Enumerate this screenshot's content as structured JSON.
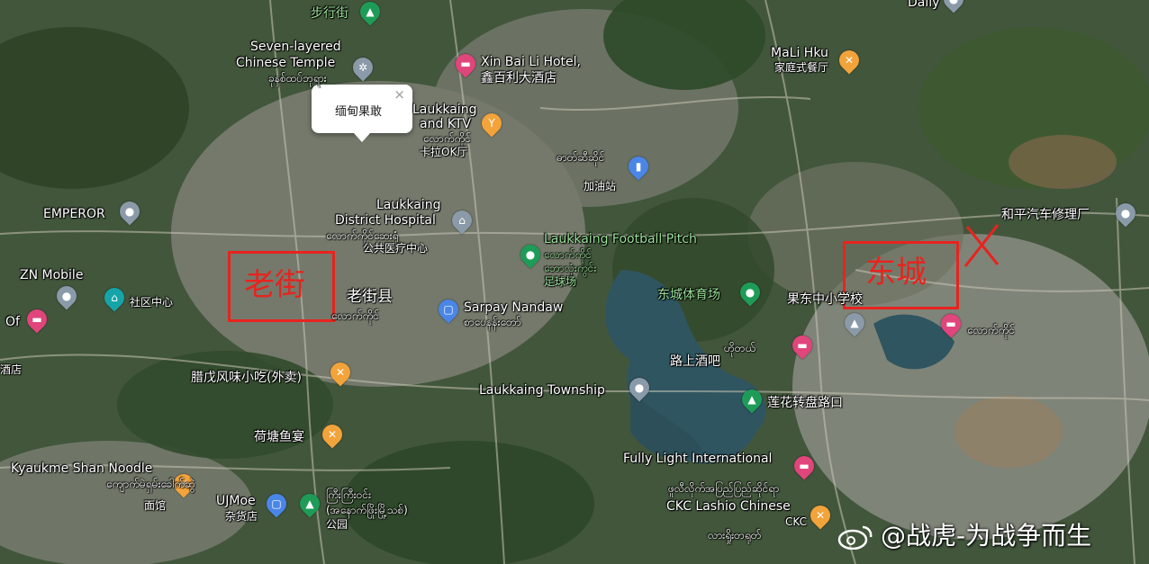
{
  "map": {
    "popup": {
      "text": "缅甸果敢",
      "close_icon": "×"
    },
    "annotations": {
      "old_street_box": "老街",
      "east_city_box": "东城",
      "cross_mark": "X"
    },
    "labels": {
      "walking_street": "步行街",
      "seven_layered_1": "Seven-layered",
      "seven_layered_2": "Chinese Temple",
      "seven_layered_sub": "ခုနစ်ထပ်ဘုရား",
      "xinbaili_1": "Xin Bai Li Hotel,",
      "xinbaili_2": "鑫百利大酒店",
      "ktv_1": "Laukkaing",
      "ktv_2": "and KTV",
      "ktv_sub": "လောက်ကိုင်",
      "ktv_3": "卡拉OK厅",
      "mali_hku": "MaLi Hku",
      "mali_hku_sub": "家庭式餐厅",
      "daily": "Daily",
      "gas_sub": "ဓာတ်ဆီဆိုင်",
      "gas_cn": "加油站",
      "emperor": "EMPEROR",
      "hospital_1": "Laukkaing",
      "hospital_2": "District Hospital",
      "hospital_sub": "လောက်ကိုင်ဆေးရုံ",
      "hospital_cn": "公共医疗中心",
      "football": "Laukkaing Football Pitch",
      "football_sub1": "လောက်ကိုင်",
      "football_sub2": "ဘောလုံးကွင်း",
      "football_cn": "足球场",
      "heping": "和平汽车修理厂",
      "zn_mobile": "ZN Mobile",
      "community": "社区中心",
      "laojie_county": "老街县",
      "laojie_county_sub": "လောက်ကိုင်",
      "sarpay_1": "Sarpay Nandaw",
      "sarpay_sub": "စာပေနန်းတော်",
      "stadium": "东城体育场",
      "school": "果东中小学校",
      "of_label": "Of",
      "hotel_sub": "ဟိုတယ်",
      "laukkaing_my": "လောက်ကိုင်",
      "lushang_bar": "路上酒吧",
      "laxu_snack": "腊戊风味小吃(外卖)",
      "township": "Laukkaing Township",
      "lotus": "莲花转盘路口",
      "hetang": "荷塘鱼宴",
      "fully_light": "Fully Light International",
      "fully_light_sub": "ဖူလီလိုက်အပြည်ပြည်ဆိုင်ရာ",
      "kyaukme_1": "Kyaukme Shan Noodle",
      "kyaukme_sub": "ကျောက်မဲရှမ်းခေါက်ဆွဲ",
      "kyaukme_cn": "面馆",
      "ujmoe": "UJMoe",
      "ujmoe_cn": "杂货店",
      "park_sub1": "ကြီးကြီးဝင်း",
      "park_sub2": "(အနောက်ဖြိုးမြို့သစ်)",
      "park_cn": "公园",
      "ckc_1": "CKC Lashio Chinese",
      "ckc_sub": "လားရှိုးတရုတ်",
      "ckc_2": "CKC",
      "left_edge": "酒店"
    },
    "watermark": "@战虎-为战争而生",
    "colors": {
      "box": "#e8231e",
      "pin_blue": "#4a86e8",
      "pin_pink": "#e0457b",
      "pin_orange": "#f2a33a",
      "pin_green": "#1e9c57",
      "pin_gray": "#8a9aa8",
      "pin_teal": "#15a4a8"
    }
  }
}
